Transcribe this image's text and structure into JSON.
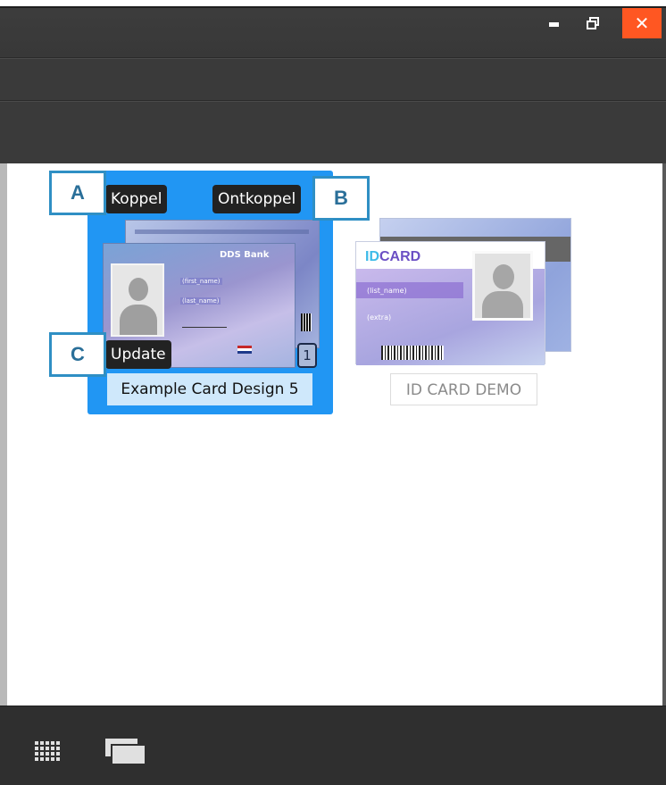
{
  "window": {
    "controls": {
      "minimize": "minimize-icon",
      "restore": "restore-icon",
      "close_glyph": "✕",
      "close_color": "#ff5722"
    }
  },
  "cards": [
    {
      "name": "Example Card Design 5",
      "selected": true,
      "badge": "1",
      "art": {
        "brand": "DDS Bank",
        "fields": [
          "(first_name)",
          "(last_name)"
        ]
      }
    },
    {
      "name": "ID CARD DEMO",
      "selected": false,
      "art": {
        "logo_prefix": "ID",
        "logo_suffix": "CARD",
        "fields": [
          "(list_name)",
          "(extra)"
        ]
      }
    }
  ],
  "actions": {
    "koppel": "Koppel",
    "ontkoppel": "Ontkoppel",
    "update": "Update"
  },
  "annotations": {
    "a": "A",
    "b": "B",
    "c": "C"
  },
  "bottombar": {
    "icons": [
      "grid-view-icon",
      "card-stack-view-icon"
    ]
  },
  "colors": {
    "selection": "#2196f3",
    "chrome": "#3a3a3a",
    "annotation_border": "#2f8fc4"
  }
}
